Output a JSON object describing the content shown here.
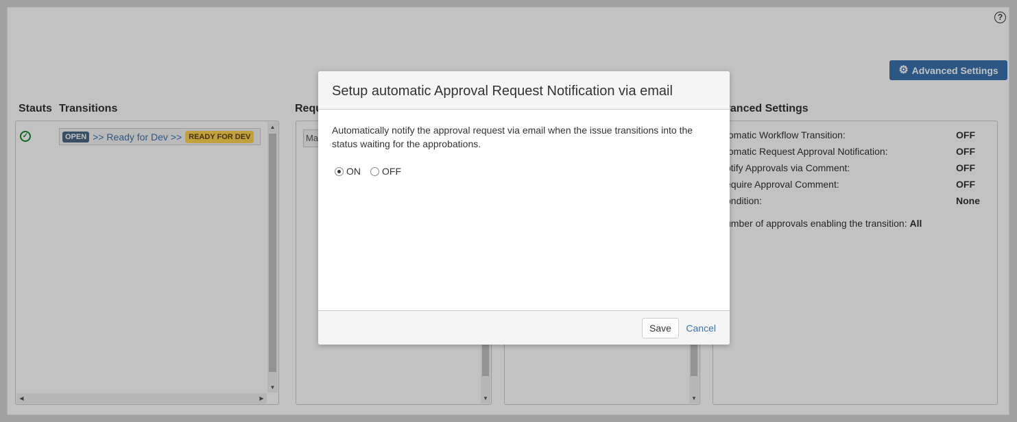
{
  "app": {
    "help_icon": "question-circle-icon",
    "advanced_settings_button": "Advanced Settings"
  },
  "columns": {
    "status": "Stauts",
    "transitions": "Transitions",
    "requirements": "Requ",
    "advanced": "vanced Settings"
  },
  "transitions": {
    "items": [
      {
        "from": "OPEN",
        "label": ">> Ready for Dev >>",
        "to": "READY FOR DEV"
      }
    ]
  },
  "requirements": {
    "field_value": "Ma"
  },
  "advanced_settings": {
    "rows": [
      {
        "label": "tomatic Workflow Transition:",
        "value": "OFF"
      },
      {
        "label": "tomatic Request Approval Notification:",
        "value": "OFF"
      },
      {
        "label": "otify Approvals via Comment:",
        "value": "OFF"
      },
      {
        "label": "equire Approval Comment:",
        "value": "OFF"
      },
      {
        "label": "ondition:",
        "value": "None"
      }
    ],
    "approvals_label": "umber of approvals enabling the transition:",
    "approvals_value": "All"
  },
  "dialog": {
    "title": "Setup automatic Approval Request Notification via email",
    "description": "Automatically notify the approval request via email when the issue transitions into the status waiting for the approbations.",
    "options": [
      {
        "label": "ON",
        "checked": true
      },
      {
        "label": "OFF",
        "checked": false
      }
    ],
    "save_label": "Save",
    "cancel_label": "Cancel"
  },
  "colors": {
    "accent": "#3b73af",
    "status_open": "#4a6785",
    "status_ready": "#ffd351",
    "success": "#14892c"
  }
}
